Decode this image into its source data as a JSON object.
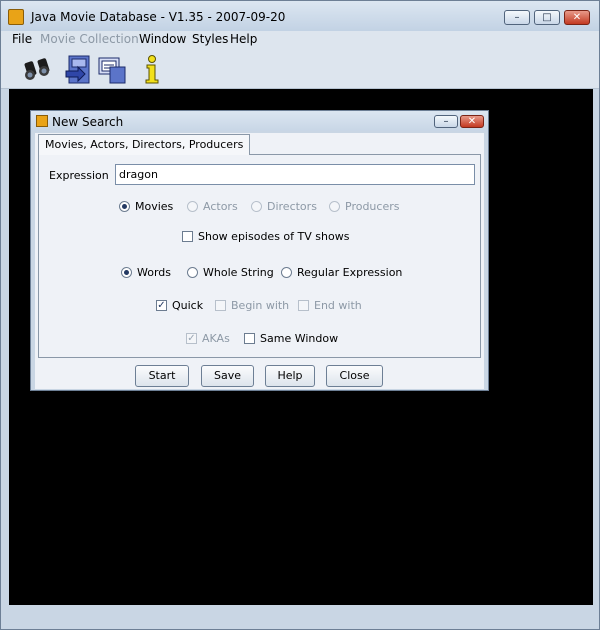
{
  "window": {
    "title": "Java Movie Database - V1.35 - 2007-09-20"
  },
  "menu": {
    "items": [
      {
        "label": "File",
        "enabled": true
      },
      {
        "label": "Movie Collection",
        "enabled": false
      },
      {
        "label": "Window",
        "enabled": true
      },
      {
        "label": "Styles",
        "enabled": true
      },
      {
        "label": "Help",
        "enabled": true
      }
    ]
  },
  "toolbar": {
    "tools": [
      {
        "icon": "binoculars-icon"
      },
      {
        "icon": "database-import-icon"
      },
      {
        "icon": "database-export-icon"
      },
      {
        "icon": "info-icon"
      }
    ]
  },
  "dialog": {
    "title": "New Search",
    "tab_label": "Movies, Actors, Directors, Producers",
    "expression_label": "Expression",
    "expression_value": "dragon",
    "search_in": [
      {
        "label": "Movies",
        "selected": true,
        "enabled": true
      },
      {
        "label": "Actors",
        "selected": false,
        "enabled": false
      },
      {
        "label": "Directors",
        "selected": false,
        "enabled": false
      },
      {
        "label": "Producers",
        "selected": false,
        "enabled": false
      }
    ],
    "show_episodes": {
      "label": "Show episodes of TV shows",
      "checked": false
    },
    "match_type": [
      {
        "label": "Words",
        "selected": true
      },
      {
        "label": "Whole String",
        "selected": false
      },
      {
        "label": "Regular Expression",
        "selected": false
      }
    ],
    "quick": {
      "label": "Quick",
      "checked": true
    },
    "begin_with": {
      "label": "Begin with",
      "checked": false,
      "enabled": false
    },
    "end_with": {
      "label": "End with",
      "checked": false,
      "enabled": false
    },
    "akas": {
      "label": "AKAs",
      "checked": true,
      "enabled": false
    },
    "same_window": {
      "label": "Same Window",
      "checked": false
    },
    "buttons": {
      "start": "Start",
      "save": "Save",
      "help": "Help",
      "close": "Close"
    }
  }
}
